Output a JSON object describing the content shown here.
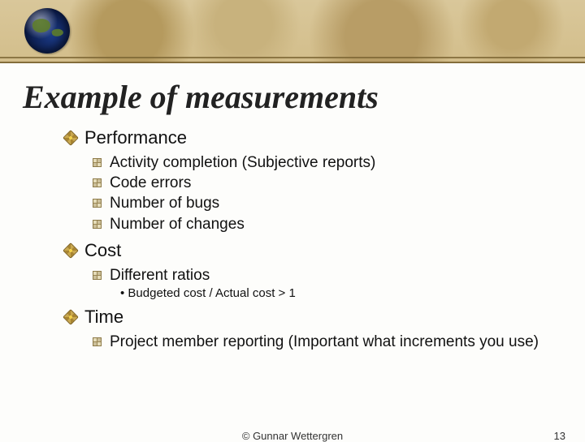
{
  "title": "Example of measurements",
  "sections": [
    {
      "heading": "Performance",
      "items": [
        {
          "text": "Activity completion (Subjective reports)"
        },
        {
          "text": "Code errors"
        },
        {
          "text": "Number of bugs"
        },
        {
          "text": "Number of changes"
        }
      ]
    },
    {
      "heading": "Cost",
      "items": [
        {
          "text": "Different ratios",
          "subitems": [
            "Budgeted cost / Actual cost > 1"
          ]
        }
      ]
    },
    {
      "heading": "Time",
      "items": [
        {
          "text": "Project member reporting (Important what increments you use)"
        }
      ]
    }
  ],
  "footer": {
    "copyright": "© Gunnar Wettergren",
    "page": "13"
  }
}
